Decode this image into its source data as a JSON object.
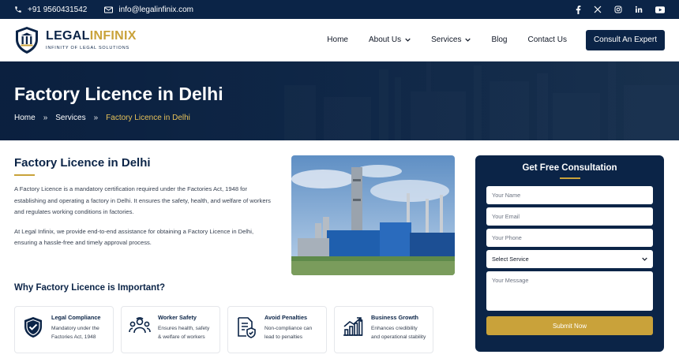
{
  "topbar": {
    "phone": "+91 9560431542",
    "email": "info@legalinfinix.com",
    "socials": [
      "facebook-icon",
      "x-icon",
      "instagram-icon",
      "linkedin-icon",
      "youtube-icon"
    ]
  },
  "brand": {
    "name_part1": "LEGAL",
    "name_part2": "INFINIX",
    "tagline": "INFINITY OF LEGAL SOLUTIONS"
  },
  "nav": {
    "home": "Home",
    "about": "About Us",
    "services": "Services",
    "blog": "Blog",
    "contact": "Contact Us",
    "cta": "Consult An Expert"
  },
  "hero": {
    "title": "Factory Licence in Delhi",
    "breadcrumb": [
      "Home",
      "Services",
      "Factory Licence in Delhi"
    ],
    "separator": "»"
  },
  "intro": {
    "heading": "Factory Licence in Delhi",
    "para1": "A Factory Licence is a mandatory certification required under the Factories Act, 1948 for establishing and operating a factory in Delhi. It ensures the safety, health, and welfare of workers and regulates working conditions in factories.",
    "para2": "At Legal Infinix, we provide end-to-end assistance for obtaining a Factory Licence in Delhi, ensuring a hassle-free and timely approval process."
  },
  "why": {
    "heading": "Why Factory Licence is Important?",
    "cards": [
      {
        "title": "Legal Compliance",
        "desc": "Mandatory under the Factories Act, 1948",
        "icon": "shield-check-icon"
      },
      {
        "title": "Worker Safety",
        "desc": "Ensures health, safety & welfare of workers",
        "icon": "workers-icon"
      },
      {
        "title": "Avoid Penalties",
        "desc": "Non-compliance can lead to penalties",
        "icon": "document-shield-icon"
      },
      {
        "title": "Business Growth",
        "desc": "Enhances credibility and operational stability",
        "icon": "growth-chart-icon"
      }
    ]
  },
  "form": {
    "title": "Get Free Consultation",
    "name_placeholder": "Your Name",
    "email_placeholder": "Your Email",
    "phone_placeholder": "Your Phone",
    "service_selected": "Select Service",
    "message_placeholder": "Your Message",
    "submit": "Submit Now"
  },
  "colors": {
    "navy": "#0b2447",
    "gold": "#c9a23a"
  }
}
